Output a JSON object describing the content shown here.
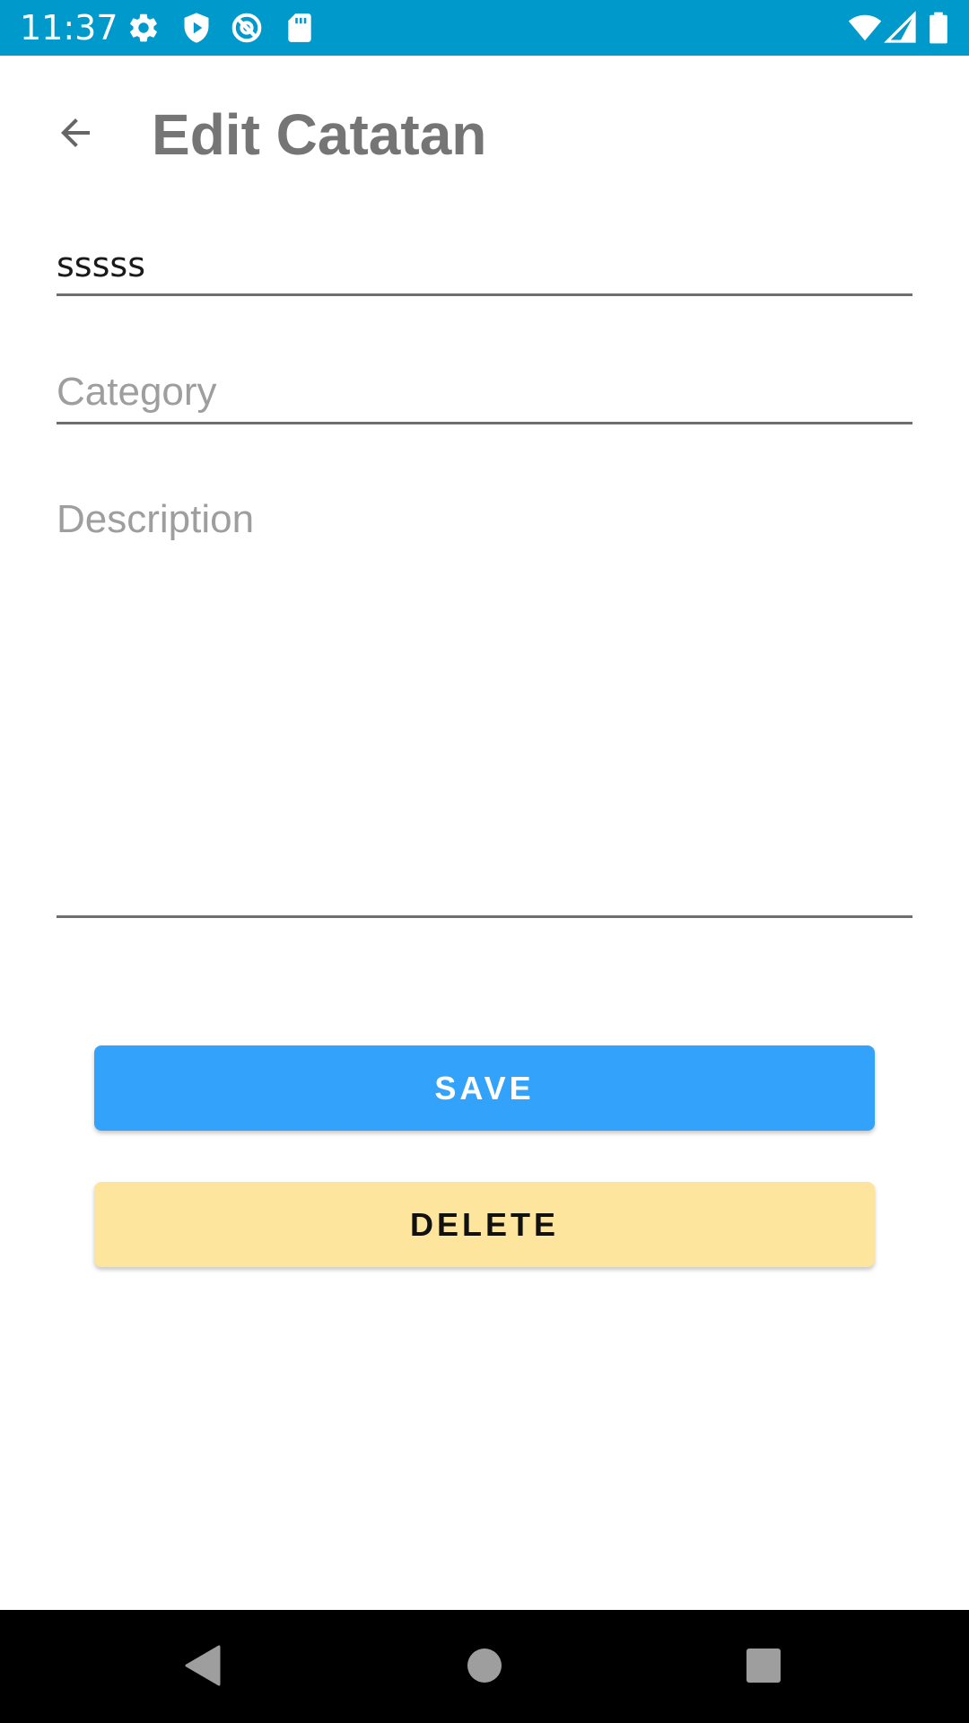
{
  "status_bar": {
    "time": "11:37",
    "icons_left": [
      "settings-icon",
      "shield-play-icon",
      "at-sign-icon",
      "sd-card-icon"
    ],
    "icons_right": [
      "wifi-icon",
      "cellular-signal-icon",
      "battery-icon"
    ],
    "background_color": "#0099cc"
  },
  "app_bar": {
    "title": "Edit Catatan",
    "back_icon": "arrow-left-icon"
  },
  "form": {
    "name": {
      "value": "sssss",
      "placeholder": ""
    },
    "category": {
      "value": "",
      "placeholder": "Category"
    },
    "description": {
      "value": "",
      "placeholder": "Description"
    }
  },
  "actions": {
    "save_label": "SAVE",
    "save_color": "#33a2fa",
    "delete_label": "DELETE",
    "delete_color": "#fde59d"
  },
  "nav_bar": {
    "back_icon": "triangle-back-icon",
    "home_icon": "circle-home-icon",
    "recents_icon": "square-recents-icon"
  }
}
